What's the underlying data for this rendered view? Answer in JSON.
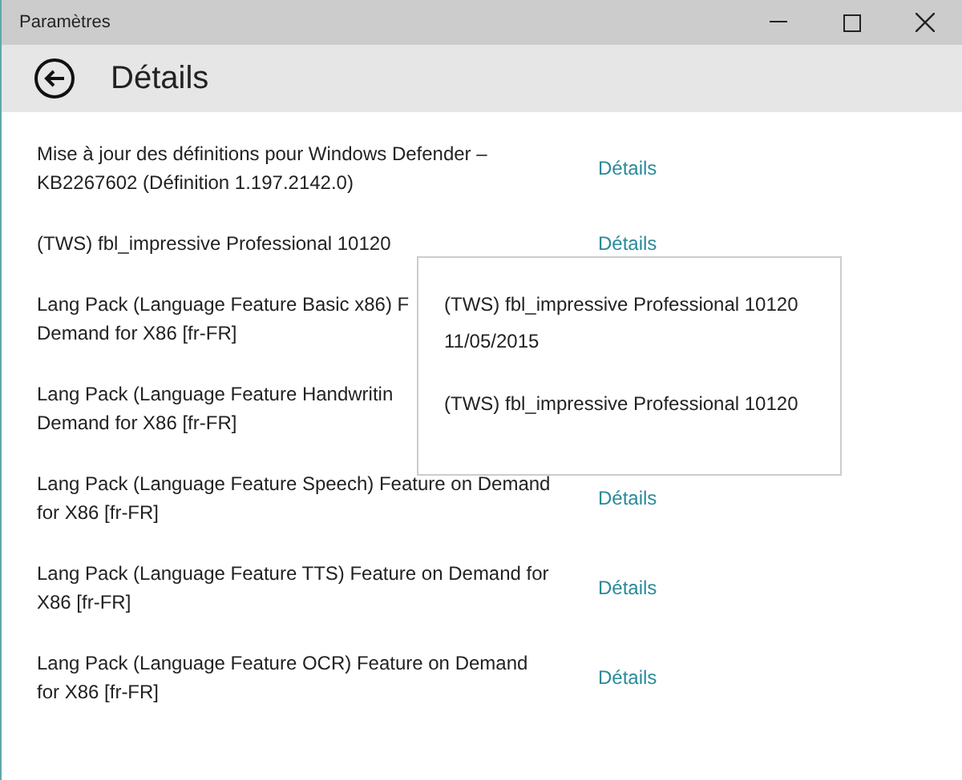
{
  "window": {
    "title": "Paramètres"
  },
  "header": {
    "title": "Détails"
  },
  "updates": [
    {
      "lines": [
        "Mise à jour des définitions pour Windows Defender –",
        "KB2267602 (Définition 1.197.2142.0)"
      ],
      "link": "Détails"
    },
    {
      "lines": [
        "(TWS) fbl_impressive Professional 10120"
      ],
      "link": "Détails"
    },
    {
      "lines": [
        "Lang Pack (Language Feature Basic x86) F",
        "Demand for X86 [fr-FR]"
      ]
    },
    {
      "lines": [
        "Lang Pack (Language Feature Handwritin",
        "Demand for X86 [fr-FR]"
      ]
    },
    {
      "lines": [
        "Lang Pack (Language Feature Speech) Feature on Demand",
        "for X86 [fr-FR]"
      ],
      "link": "Détails"
    },
    {
      "lines": [
        "Lang Pack (Language Feature TTS) Feature on Demand for",
        "X86 [fr-FR]"
      ],
      "link": "Détails"
    },
    {
      "lines": [
        "Lang Pack (Language Feature OCR) Feature on Demand",
        "for X86 [fr-FR]"
      ],
      "link": "Détails"
    }
  ],
  "tooltip": {
    "name": "(TWS) fbl_impressive Professional 10120",
    "date": "11/05/2015",
    "description": "(TWS) fbl_impressive Professional 10120"
  }
}
